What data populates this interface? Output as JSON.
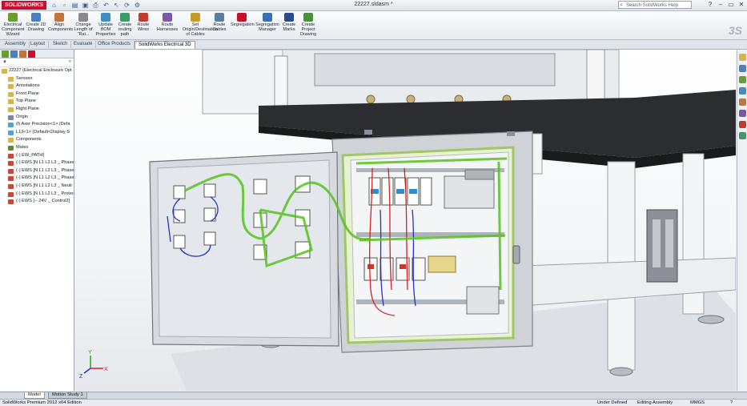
{
  "app": {
    "logo_text": "SOLIDWORKS",
    "document_title": "22227.sldasm *",
    "help_placeholder": "Search SolidWorks Help"
  },
  "ribbon": {
    "commands": [
      {
        "label": "Electrical Component Wizard",
        "color": "#6a9e2f"
      },
      {
        "label": "Create 2D Drawing",
        "color": "#4a7fc1"
      },
      {
        "label": "Align Components",
        "color": "#c0763a"
      },
      {
        "label": "Change Length of \"Rai...",
        "color": "#8a8a8a"
      },
      {
        "label": "Update BOM Properties",
        "color": "#3f8fc4"
      },
      {
        "label": "Create routing path",
        "color": "#3f9a6a"
      },
      {
        "label": "Route Wires",
        "color": "#c23b2e"
      },
      {
        "label": "Route Harnesses",
        "color": "#7a58a8"
      },
      {
        "label": "Set Origin/Destination of Cables",
        "color": "#c79b2a"
      },
      {
        "label": "Route Cables",
        "color": "#5b7d9a"
      },
      {
        "label": "Segregation",
        "color": "#c8102e"
      },
      {
        "label": "Segregation Manager",
        "color": "#3b6fb0"
      },
      {
        "label": "Create Marks",
        "color": "#2b4c8c"
      },
      {
        "label": "Create Project Drawing",
        "color": "#4a8f3c"
      }
    ]
  },
  "tabs": [
    {
      "label": "Assembly",
      "active": false
    },
    {
      "label": "Layout",
      "active": false
    },
    {
      "label": "Sketch",
      "active": false
    },
    {
      "label": "Evaluate",
      "active": false
    },
    {
      "label": "Office Products",
      "active": false
    },
    {
      "label": "SolidWorks Electrical 3D",
      "active": true
    }
  ],
  "tree": {
    "root": "22227  (Electrical Enclosure Opt",
    "items": [
      {
        "label": "Sensors",
        "color": "#d8b54a"
      },
      {
        "label": "Annotations",
        "color": "#d8b54a"
      },
      {
        "label": "Front Plane",
        "color": "#d8b54a"
      },
      {
        "label": "Top Plane",
        "color": "#d8b54a"
      },
      {
        "label": "Right Plane",
        "color": "#d8b54a"
      },
      {
        "label": "Origin",
        "color": "#7a8a9a"
      },
      {
        "label": "(f) Axer Precision<1> (Defa",
        "color": "#5aa0c8"
      },
      {
        "label": "L1|I<1> (Default<Display S",
        "color": "#5aa0c8"
      },
      {
        "label": "Components",
        "color": "#d8b54a"
      },
      {
        "label": "Mates",
        "color": "#5a8a3a"
      },
      {
        "label": "(-) EW_PATH]",
        "color": "#c34a3a"
      },
      {
        "label": "(-) EWS [N L1 L2 L3 _ Phase",
        "color": "#c34a3a"
      },
      {
        "label": "(-) EWS [N L1 L2 L3 _ Phase",
        "color": "#c34a3a"
      },
      {
        "label": "(-) EWS [N L1 L2 L3 _ Phase",
        "color": "#c34a3a"
      },
      {
        "label": "(-) EWS [N L1 L2 L3 _ Neutr",
        "color": "#c34a3a"
      },
      {
        "label": "(-) EWS [N L1 L2 L3 _ Protec",
        "color": "#c34a3a"
      },
      {
        "label": "(-) EWS [-- 24V _ Control2]",
        "color": "#c34a3a"
      }
    ]
  },
  "bottom_tabs": [
    {
      "label": "Model",
      "active": true
    },
    {
      "label": "Motion Study 1",
      "active": false
    }
  ],
  "status": {
    "edition": "SolidWorks Premium 2012 x64 Edition",
    "state": "Under Defined",
    "mode": "Editing Assembly",
    "units": "MMGS"
  },
  "triad": {
    "x": "X",
    "y": "Y",
    "z": "Z"
  }
}
